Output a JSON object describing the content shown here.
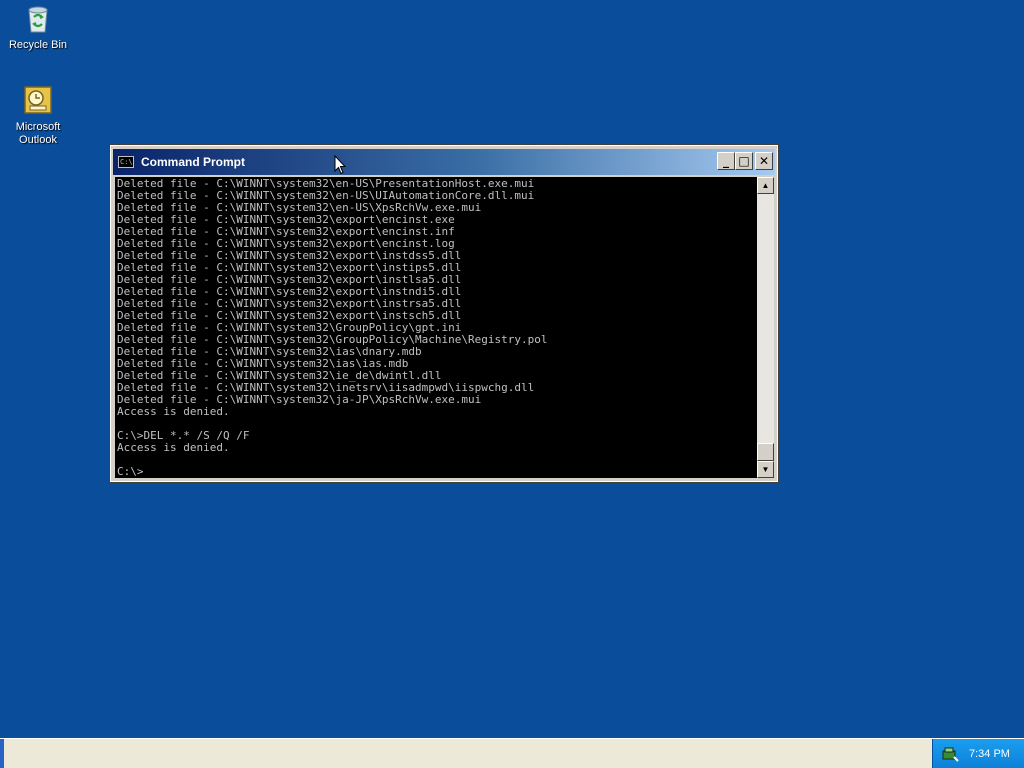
{
  "desktop": {
    "icons": [
      {
        "label": "Recycle Bin",
        "icon": "recycle-bin-icon"
      },
      {
        "label": "Microsoft\nOutlook",
        "icon": "outlook-icon"
      }
    ]
  },
  "window": {
    "title": "Command Prompt",
    "buttons": {
      "minimize": "_",
      "maximize": "□",
      "close": "✕"
    },
    "console_lines": [
      "Deleted file - C:\\WINNT\\system32\\en-US\\PresentationHost.exe.mui",
      "Deleted file - C:\\WINNT\\system32\\en-US\\UIAutomationCore.dll.mui",
      "Deleted file - C:\\WINNT\\system32\\en-US\\XpsRchVw.exe.mui",
      "Deleted file - C:\\WINNT\\system32\\export\\encinst.exe",
      "Deleted file - C:\\WINNT\\system32\\export\\encinst.inf",
      "Deleted file - C:\\WINNT\\system32\\export\\encinst.log",
      "Deleted file - C:\\WINNT\\system32\\export\\instdss5.dll",
      "Deleted file - C:\\WINNT\\system32\\export\\instips5.dll",
      "Deleted file - C:\\WINNT\\system32\\export\\instlsa5.dll",
      "Deleted file - C:\\WINNT\\system32\\export\\instndi5.dll",
      "Deleted file - C:\\WINNT\\system32\\export\\instrsa5.dll",
      "Deleted file - C:\\WINNT\\system32\\export\\instsch5.dll",
      "Deleted file - C:\\WINNT\\system32\\GroupPolicy\\gpt.ini",
      "Deleted file - C:\\WINNT\\system32\\GroupPolicy\\Machine\\Registry.pol",
      "Deleted file - C:\\WINNT\\system32\\ias\\dnary.mdb",
      "Deleted file - C:\\WINNT\\system32\\ias\\ias.mdb",
      "Deleted file - C:\\WINNT\\system32\\ie_de\\dwintl.dll",
      "Deleted file - C:\\WINNT\\system32\\inetsrv\\iisadmpwd\\iispwchg.dll",
      "Deleted file - C:\\WINNT\\system32\\ja-JP\\XpsRchVw.exe.mui",
      "Access is denied.",
      "",
      "C:\\>DEL *.* /S /Q /F",
      "Access is denied.",
      "",
      "C:\\>"
    ]
  },
  "taskbar": {
    "clock": "7:34 PM"
  },
  "colors": {
    "desktop": "#0a4e9b",
    "console_bg": "#000000",
    "console_fg": "#c0c0c0"
  }
}
